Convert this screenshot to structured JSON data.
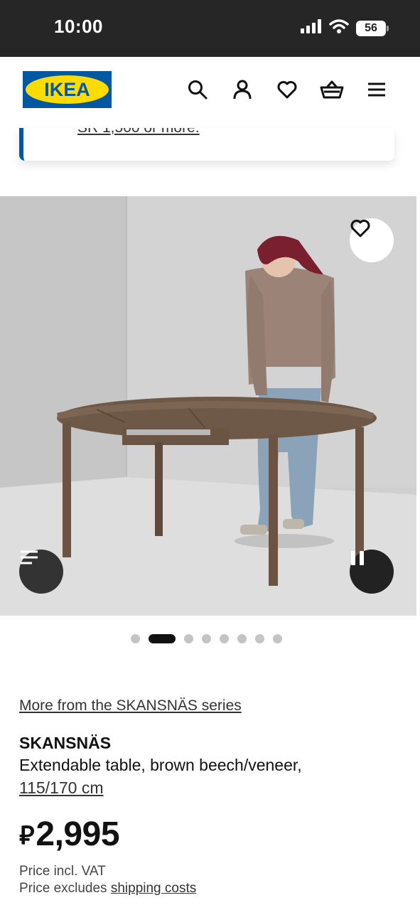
{
  "status_bar": {
    "time": "10:00",
    "battery": "56"
  },
  "header": {
    "logo_text": "IKEA",
    "icons": [
      "search-icon",
      "account-icon",
      "favourites-icon",
      "basket-icon",
      "menu-icon"
    ]
  },
  "promo": {
    "text": "SR 1,500 or more."
  },
  "media": {
    "carousel": {
      "count": 8,
      "active_index": 1
    }
  },
  "product": {
    "series_link": "More from the SKANSNÄS series",
    "name": "SKANSNÄS",
    "description": "Extendable table, brown beech/veneer,",
    "size": "115/170 cm",
    "currency_symbol": "⃁",
    "price": "2,995",
    "price_note": "Price incl. VAT",
    "price_excludes_prefix": "Price excludes ",
    "shipping_link": "shipping costs"
  },
  "colors": {
    "brand_blue": "#0058a3",
    "brand_yellow": "#ffdb00",
    "status_bar_bg": "#262626",
    "text": "#111111"
  }
}
